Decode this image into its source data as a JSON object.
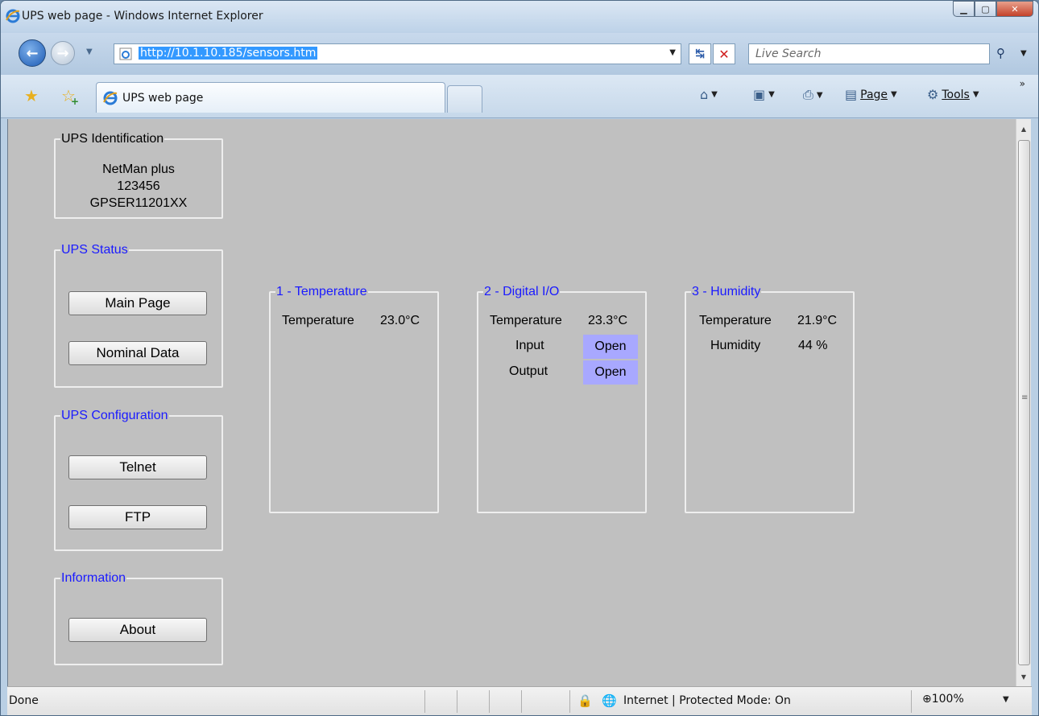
{
  "window": {
    "title": "UPS web page - Windows Internet Explorer"
  },
  "address": {
    "url": "http://10.1.10.185/sensors.htm",
    "search_placeholder": "Live Search"
  },
  "tabs": {
    "active_title": "UPS web page"
  },
  "commands": {
    "page_label": "Page",
    "tools_label": "Tools"
  },
  "sidebar": {
    "identification": {
      "legend": "UPS Identification",
      "lines": [
        "NetMan plus",
        "123456",
        "GPSER11201XX"
      ]
    },
    "status": {
      "legend": "UPS Status",
      "buttons": [
        "Main Page",
        "Nominal Data"
      ]
    },
    "configuration": {
      "legend": "UPS Configuration",
      "buttons": [
        "Telnet",
        "FTP"
      ]
    },
    "information": {
      "legend": "Information",
      "buttons": [
        "About"
      ]
    }
  },
  "sensors": [
    {
      "title": "1 - Temperature",
      "rows": [
        {
          "label": "Temperature",
          "value": "23.0°C"
        }
      ]
    },
    {
      "title": "2 - Digital I/O",
      "rows": [
        {
          "label": "Temperature",
          "value": "23.3°C"
        },
        {
          "label": "Input",
          "value": "Open"
        },
        {
          "label": "Output",
          "value": "Open"
        }
      ]
    },
    {
      "title": "3 - Humidity",
      "rows": [
        {
          "label": "Temperature",
          "value": "21.9°C"
        },
        {
          "label": "Humidity",
          "value": "44 %"
        }
      ]
    }
  ],
  "statusbar": {
    "status": "Done",
    "zone": "Internet | Protected Mode: On",
    "zoom": "100%"
  },
  "icons": {
    "ie": "ie-logo-icon",
    "back": "back-arrow-icon",
    "forward": "forward-arrow-icon",
    "refresh": "refresh-icon",
    "stop": "stop-icon",
    "search": "search-icon",
    "favorites": "favorites-star-icon",
    "add_favorites": "add-favorites-icon",
    "home": "home-icon",
    "feeds": "feeds-icon",
    "print": "print-icon",
    "page": "page-icon",
    "tools": "tools-gear-icon"
  },
  "colors": {
    "content_bg": "#c0c0c0",
    "legend_blue": "#1a1aff",
    "open_badge": "#a8a8ff"
  }
}
